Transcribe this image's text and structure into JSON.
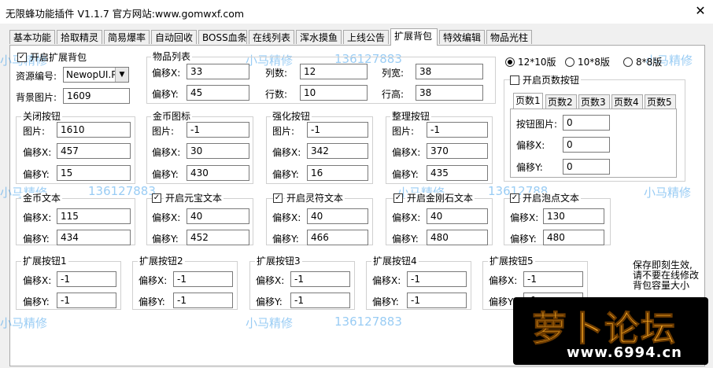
{
  "window": {
    "title": "无限蜂功能插件 V1.1.7   官方网站:www.gomwxf.com",
    "close_glyph": "✕"
  },
  "tabs": [
    "基本功能",
    "拾取精灵",
    "简易爆率",
    "自动回收",
    "BOSS血条",
    "在线列表",
    "浑水摸鱼",
    "上线公告",
    "扩展背包",
    "特效编辑",
    "物品光柱"
  ],
  "active_tab": "扩展背包",
  "enable_bag": {
    "label": "开启扩展背包",
    "checked": true
  },
  "resource": {
    "label": "资源编号:",
    "value": "NewopUI.Pak"
  },
  "background": {
    "label": "背景图片:",
    "value": "1609"
  },
  "item_list": {
    "title": "物品列表",
    "offset_x_label": "偏移X:",
    "offset_x": "33",
    "offset_y_label": "偏移Y:",
    "offset_y": "45",
    "cols_label": "列数:",
    "cols": "12",
    "rows_label": "行数:",
    "rows": "10",
    "col_width_label": "列宽:",
    "col_width": "38",
    "row_height_label": "行高:",
    "row_height": "38"
  },
  "layout_radios": {
    "options": [
      "12*10版",
      "10*8版",
      "8*8版"
    ],
    "selected": "12*10版"
  },
  "page_buttons": {
    "label": "开启页数按钮",
    "checked": false,
    "subtabs": [
      "页数1",
      "页数2",
      "页数3",
      "页数4",
      "页数5"
    ],
    "active": "页数1",
    "image_label": "按钮图片:",
    "image": "0",
    "offset_x_label": "偏移X:",
    "offset_x": "0",
    "offset_y_label": "偏移Y:",
    "offset_y": "0"
  },
  "close_button": {
    "title": "关闭按钮",
    "image_label": "图片:",
    "image": "1610",
    "offset_x_label": "偏移X:",
    "offset_x": "457",
    "offset_y_label": "偏移Y:",
    "offset_y": "15"
  },
  "gold_icon": {
    "title": "金币图标",
    "image_label": "图片:",
    "image": "-1",
    "offset_x_label": "偏移X:",
    "offset_x": "30",
    "offset_y_label": "偏移Y:",
    "offset_y": "430"
  },
  "enhance_button": {
    "title": "强化按钮",
    "image_label": "图片:",
    "image": "-1",
    "offset_x_label": "偏移X:",
    "offset_x": "342",
    "offset_y_label": "偏移Y:",
    "offset_y": "16"
  },
  "sort_button": {
    "title": "整理按钮",
    "image_label": "图片:",
    "image": "-1",
    "offset_x_label": "偏移X:",
    "offset_x": "370",
    "offset_y_label": "偏移Y:",
    "offset_y": "435"
  },
  "gold_text": {
    "title": "金币文本",
    "offset_x_label": "偏移X:",
    "offset_x": "115",
    "offset_y_label": "偏移Y:",
    "offset_y": "434"
  },
  "yuanbao_text": {
    "title": "开启元宝文本",
    "checked": true,
    "offset_x_label": "偏移X:",
    "offset_x": "40",
    "offset_y_label": "偏移Y:",
    "offset_y": "452"
  },
  "lingfu_text": {
    "title": "开启灵符文本",
    "checked": true,
    "offset_x_label": "偏移X:",
    "offset_x": "40",
    "offset_y_label": "偏移Y:",
    "offset_y": "466"
  },
  "diamond_text": {
    "title": "开启金刚石文本",
    "checked": true,
    "offset_x_label": "偏移X:",
    "offset_x": "40",
    "offset_y_label": "偏移Y:",
    "offset_y": "480"
  },
  "bubble_text": {
    "title": "开启泡点文本",
    "checked": true,
    "offset_x_label": "偏移X:",
    "offset_x": "130",
    "offset_y_label": "偏移Y:",
    "offset_y": "480"
  },
  "ext_buttons": [
    {
      "title": "扩展按钮1",
      "offset_x_label": "偏移X:",
      "offset_x": "-1",
      "offset_y_label": "偏移Y:",
      "offset_y": "-1"
    },
    {
      "title": "扩展按钮2",
      "offset_x_label": "偏移X:",
      "offset_x": "-1",
      "offset_y_label": "偏移Y:",
      "offset_y": "-1"
    },
    {
      "title": "扩展按钮3",
      "offset_x_label": "偏移X:",
      "offset_x": "-1",
      "offset_y_label": "偏移Y:",
      "offset_y": "-1"
    },
    {
      "title": "扩展按钮4",
      "offset_x_label": "偏移X:",
      "offset_x": "-1",
      "offset_y_label": "偏移Y:",
      "offset_y": "-1"
    },
    {
      "title": "扩展按钮5",
      "offset_x_label": "偏移X:",
      "offset_x": "-1",
      "offset_y_label": "偏移Y:",
      "offset_y": "-1"
    }
  ],
  "note": [
    "保存即刻生效,",
    "请不要在线修改",
    "背包容量大小"
  ],
  "watermark": {
    "name": "小马精修",
    "phone": "136127883",
    "phone_full": "13612788"
  },
  "logo": {
    "text": "萝卜论坛",
    "url": "www.6994.cn"
  },
  "colors": {
    "watermark": "#1e8fe8",
    "logo_bg": "#000000",
    "logo_text": "#f5a623"
  }
}
